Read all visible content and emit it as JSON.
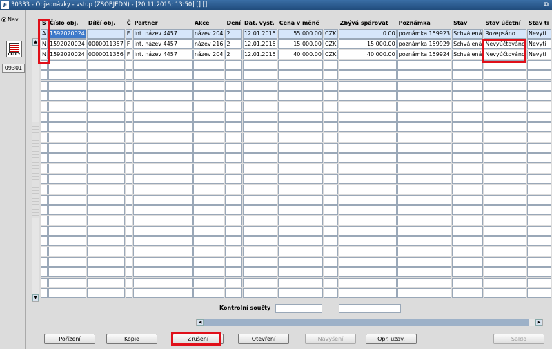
{
  "window": {
    "title": "30333 - Objednávky - vstup (ZSOBJEDN) - [20.11.2015; 13:50] [] []",
    "restore_glyph": "⧉"
  },
  "left": {
    "nav_label": "Nav",
    "ukoly_label": "ÚKOLY",
    "code": "09301"
  },
  "columns": [
    "S",
    "Číslo obj.",
    "Dílčí obj.",
    "Č",
    "Partner",
    "Akce",
    "Dení",
    "Dat. vyst.",
    "Cena v měně",
    "",
    "Zbývá spárovat",
    "Poznámka",
    "Stav",
    "Stav účetní",
    "Stav ti"
  ],
  "rows": [
    [
      "A",
      "1592020024",
      "",
      "F",
      "int. název 4457",
      "název 204",
      "2",
      "12.01.2015",
      "55 000.00",
      "CZK",
      "0.00",
      "poznámka 159923",
      "Schválená",
      "Rozepsáno",
      "Nevyti"
    ],
    [
      "N",
      "1592020024",
      "0000011357",
      "F",
      "int. název 4457",
      "název 216",
      "2",
      "12.01.2015",
      "15 000.00",
      "CZK",
      "15 000.00",
      "poznámka 159929",
      "Schválená",
      "Nevyúčtováno",
      "Nevyti"
    ],
    [
      "N",
      "1592020024",
      "0000011356",
      "F",
      "int. název 4457",
      "název 204",
      "2",
      "12.01.2015",
      "40 000.00",
      "CZK",
      "40 000.00",
      "poznámka 159924",
      "Schválená",
      "Nevyúčtováno",
      "Nevyti"
    ]
  ],
  "empty_row_count": 23,
  "totals": {
    "label": "Kontrolní součty"
  },
  "buttons": {
    "porizeni": "Pořízení",
    "kopie": "Kopie",
    "zruseni": "Zrušení",
    "otevreni": "Otevření",
    "navyseni": "Navýšení",
    "opr_uzav": "Opr. uzav.",
    "saldo": "Saldo"
  },
  "colors": {
    "highlight": "#e0101a",
    "selected_row": "#d6e6fa",
    "current_cell": "#3d79c9"
  }
}
